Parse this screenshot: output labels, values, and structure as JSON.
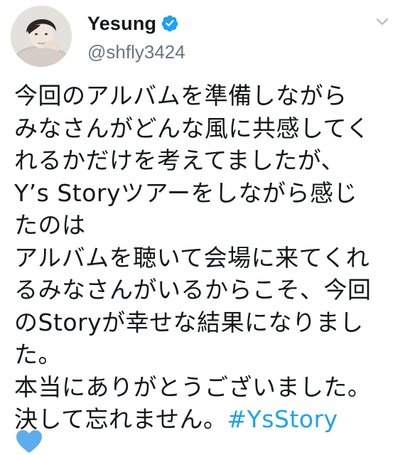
{
  "tweet": {
    "display_name": "Yesung",
    "handle": "@shfly3424",
    "verified": true,
    "lines": [
      "今回のアルバムを準備しながら",
      "みなさんがどんな風に共感してく",
      "れるかだけを考えてましたが、",
      "Y’s Storyツアーをしながら感じ",
      "たのは",
      "アルバムを聴いて会場に来てくれ",
      "るみなさんがいるからこそ、今回",
      "のStoryが幸せな結果になりまし",
      "た。",
      "本当にありがとうございました。"
    ],
    "last_line_text": "決して忘れません。",
    "hashtag": "#YsStory",
    "emoji": "blue-heart-icon"
  },
  "colors": {
    "text": "#14171a",
    "secondary": "#657786",
    "link": "#1da1f2",
    "heart": "#5dadec"
  }
}
